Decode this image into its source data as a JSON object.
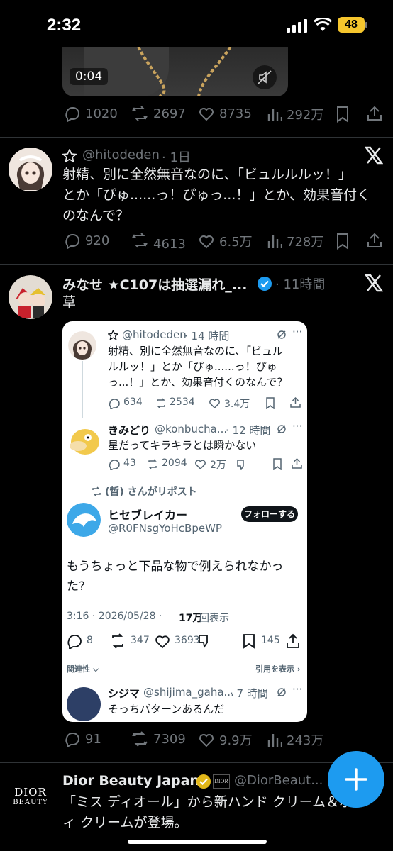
{
  "status_bar": {
    "time": "2:32",
    "battery": "48"
  },
  "video": {
    "duration": "0:04"
  },
  "tweet0": {
    "replies": "1020",
    "reposts": "2697",
    "likes": "8735",
    "views": "292万"
  },
  "tweet1": {
    "handle": "@hitodeden",
    "time": "· 1日",
    "text_lines": [
      "射精、別に全然無音なのに、「ビュルルルッ！」",
      "とか「ぴゅ......っ！ぴゅっ...！」とか、効果音付く",
      "のなんで？"
    ],
    "replies": "920",
    "reposts": "4613",
    "likes": "6.5万",
    "views": "728万"
  },
  "tweet2": {
    "name": "みなせ ★C107は抽選漏れ_...",
    "time": "· 11時間",
    "text": "草",
    "replies": "91",
    "reposts": "7309",
    "likes": "9.9万",
    "views": "243万"
  },
  "screenshot": {
    "t1": {
      "handle": "@hitodeden",
      "time": "· 14 時間",
      "lines": [
        "射精、別に全然無音なのに、「ビュル",
        "ルルッ！」とか「ぴゅ......っ！ぴゅ",
        "っ...！」とか、効果音付くのなんで？"
      ],
      "replies": "634",
      "reposts": "2534",
      "likes": "3.4万"
    },
    "t2": {
      "name": "きみどり",
      "handle": "@konbucha...",
      "time": "· 12 時間",
      "text": "星だってキラキラとは瞬かない",
      "replies": "43",
      "reposts": "2094",
      "likes": "2万"
    },
    "repost_label": "(哲) さんがリポスト",
    "t3": {
      "name": "ヒセブレイカー",
      "handle": "@R0FNsgYoHcBpeWP",
      "follow": "フォローする",
      "lines": [
        "もうちょっと下品な物で例えられなかっ",
        "た?"
      ],
      "date": "3:16 · 2026/05/28 ·",
      "views_num": "17万",
      "views_label": "回表示",
      "replies": "8",
      "reposts": "347",
      "likes": "3693",
      "bookmarks": "145"
    },
    "relevance": "関連性",
    "quotes": "引用を表示",
    "t4": {
      "name": "シジマ",
      "handle": "@shijima_gaha...",
      "time": "· 7 時間",
      "text": "そっちパターンあるんだ"
    }
  },
  "ad": {
    "name": "Dior Beauty Japan",
    "handle": "@DiorBeaut...",
    "logo_line1": "DIOR",
    "logo_line2": "BEAUTY",
    "small_logo": "DIOR",
    "lines": [
      "「ミス ディオール」から新ハンド クリーム＆ボデ",
      "ィ クリームが登場。"
    ]
  },
  "colors": {
    "accent": "#1d9bf0",
    "muted": "#71767b",
    "gold_badge": "#e2b719"
  }
}
